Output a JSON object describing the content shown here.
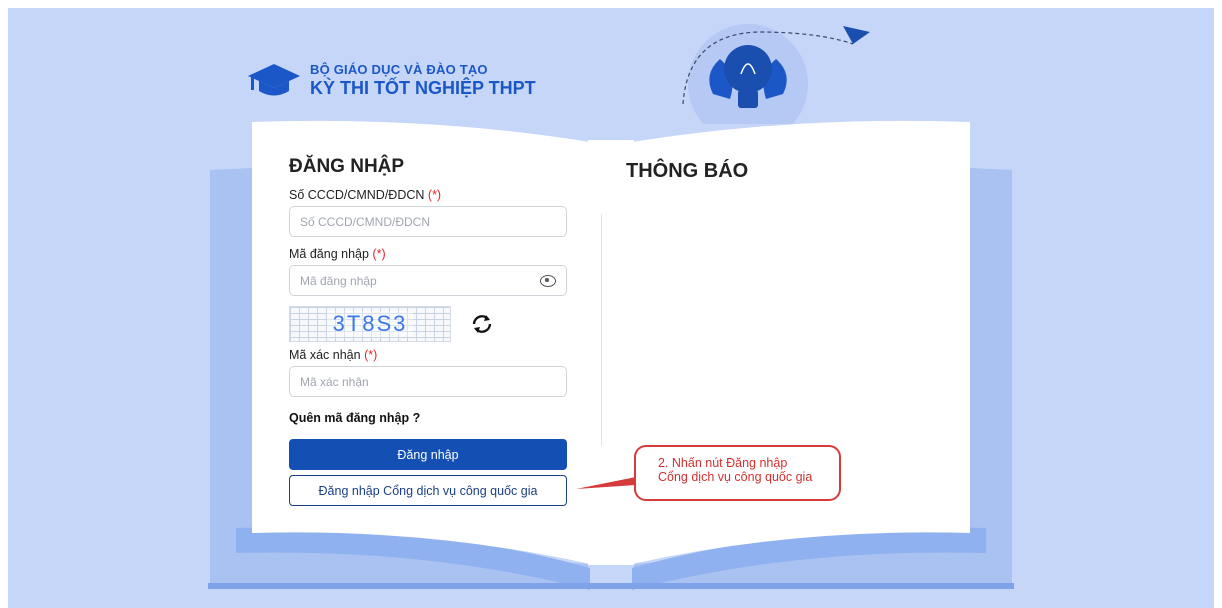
{
  "brand": {
    "line1": "BỘ GIÁO DỤC VÀ ĐÀO TẠO",
    "line2": "KỲ THI TỐT NGHIỆP THPT"
  },
  "login": {
    "title": "ĐĂNG NHẬP",
    "id_label": "Số CCCD/CMND/ĐDCN",
    "id_placeholder": "Số CCCD/CMND/ĐDCN",
    "code_label": "Mã đăng nhập",
    "code_placeholder": "Mã đăng nhập",
    "captcha_text": "3T8S3",
    "verify_label": "Mã xác nhận",
    "verify_placeholder": "Mã xác nhận",
    "required_mark": "(*)",
    "forgot_link": "Quên mã đăng nhập ?",
    "login_button": "Đăng nhập",
    "national_portal_button": "Đăng nhập Cổng dịch vụ công quốc gia"
  },
  "notice": {
    "title": "THÔNG BÁO"
  },
  "callout": {
    "line1": "2. Nhấn nút Đăng nhập",
    "line2": "Cổng dịch vụ công quốc gia"
  },
  "colors": {
    "background": "#c6d6f8",
    "primary": "#1450b4",
    "brand_text": "#1b57c6",
    "required": "#e0262c",
    "callout_border": "#d63a3a"
  },
  "icons": [
    "graduation-cap-icon",
    "lightbulb-icon",
    "paper-plane-icon",
    "eye-icon",
    "refresh-icon"
  ]
}
